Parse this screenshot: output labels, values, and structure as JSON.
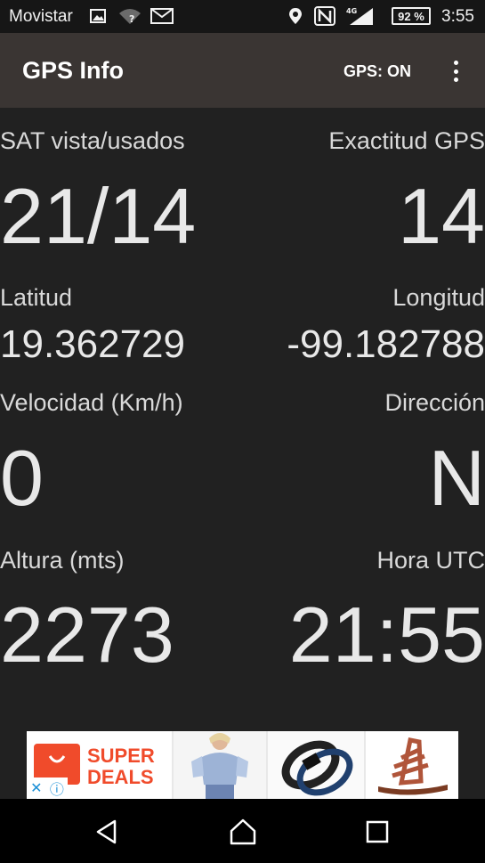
{
  "status_bar": {
    "carrier": "Movistar",
    "network": "4G",
    "battery": "92 %",
    "time": "3:55"
  },
  "app_bar": {
    "title": "GPS Info",
    "gps_status": "GPS: ON"
  },
  "metrics": {
    "satellites": {
      "label": "SAT vista/usados",
      "value": "21/14"
    },
    "accuracy": {
      "label": "Exactitud GPS",
      "value": "14"
    },
    "latitude": {
      "label": "Latitud",
      "value": "19.362729"
    },
    "longitude": {
      "label": "Longitud",
      "value": "-99.182788"
    },
    "speed": {
      "label": "Velocidad (Km/h)",
      "value": "0"
    },
    "direction": {
      "label": "Dirección",
      "value": "N"
    },
    "altitude": {
      "label": "Altura (mts)",
      "value": "2273"
    },
    "utc_time": {
      "label": "Hora UTC",
      "value": "21:55"
    }
  },
  "ad": {
    "line1": "SUPER",
    "line2": "DEALS",
    "accent_color": "#f04b2b"
  },
  "colors": {
    "background": "#212121",
    "app_bar": "#3a3533",
    "status_bar": "#161616"
  }
}
